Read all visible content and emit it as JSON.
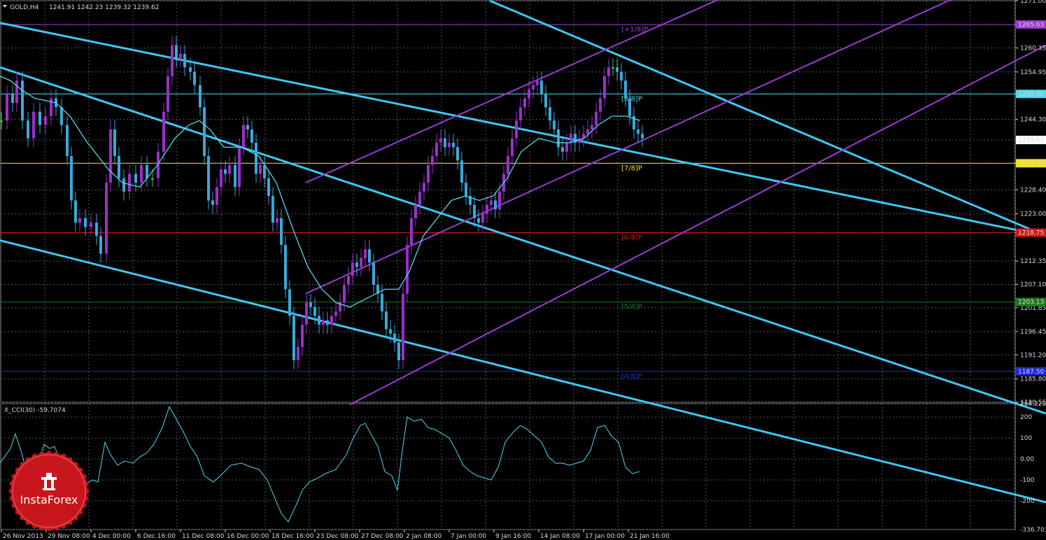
{
  "colors": {
    "background": "#000000",
    "grid": "#4a5a6a",
    "bull_candle": "#9a30c8",
    "bear_candle": "#3aa8d8",
    "neutral_candle": "#2ec84a",
    "ma_line": "#52d8e8",
    "trend_channel": "#3ec8f0",
    "regression_channel": "#9a3ccf",
    "cci_line": "#52d8e8",
    "murrey_plus1": "#9a3ccf",
    "murrey_8": "#52d8e8",
    "murrey_7": "#f0e020",
    "murrey_6": "#d81818",
    "murrey_5": "#1e7a1e",
    "murrey_4": "#1d2ad8",
    "logo_red": "#c8161d"
  },
  "header": {
    "symbol_text": "GOLD,H4",
    "ohlc_text": "1241.91 1242.23 1239.32 1239.62"
  },
  "logo": {
    "name": "InstaForex"
  },
  "chart_data": [
    {
      "type": "candlestick",
      "title": "GOLD,H4",
      "ylim": [
        1180.55,
        1271.0
      ],
      "y_ticks": [
        "1271.00",
        "1265.63",
        "1260.35",
        "1254.95",
        "1250.00",
        "1244.30",
        "1239.62",
        "1234.38",
        "1228.40",
        "1223.00",
        "1218.75",
        "1212.35",
        "1207.10",
        "1201.85",
        "1196.45",
        "1191.20",
        "1185.80",
        "1180.55"
      ],
      "x_ticks": [
        "26 Nov 2013",
        "29 Nov 08:00",
        "4 Dec 00:00",
        "6 Dec 16:00",
        "11 Dec 08:00",
        "16 Dec 00:00",
        "18 Dec 16:00",
        "23 Dec 08:00",
        "27 Dec 08:00",
        "2 Jan 08:00",
        "7 Jan 00:00",
        "9 Jan 16:00",
        "14 Jan 08:00",
        "17 Jan 00:00",
        "21 Jan 16:00"
      ],
      "price_series": [
        [
          0,
          1244
        ],
        [
          8,
          1250
        ],
        [
          16,
          1248
        ],
        [
          22,
          1253
        ],
        [
          30,
          1244
        ],
        [
          38,
          1240
        ],
        [
          46,
          1246
        ],
        [
          55,
          1243
        ],
        [
          63,
          1245
        ],
        [
          71,
          1249
        ],
        [
          78,
          1247
        ],
        [
          86,
          1243
        ],
        [
          94,
          1236
        ],
        [
          100,
          1226
        ],
        [
          106,
          1221
        ],
        [
          112,
          1222
        ],
        [
          120,
          1220
        ],
        [
          128,
          1221
        ],
        [
          136,
          1218
        ],
        [
          142,
          1214
        ],
        [
          150,
          1230
        ],
        [
          156,
          1242
        ],
        [
          162,
          1236
        ],
        [
          168,
          1231
        ],
        [
          175,
          1228
        ],
        [
          183,
          1232
        ],
        [
          192,
          1230
        ],
        [
          200,
          1234
        ],
        [
          208,
          1231
        ],
        [
          216,
          1231
        ],
        [
          224,
          1237
        ],
        [
          232,
          1246
        ],
        [
          238,
          1254
        ],
        [
          244,
          1261
        ],
        [
          250,
          1258
        ],
        [
          256,
          1259
        ],
        [
          262,
          1256
        ],
        [
          270,
          1255
        ],
        [
          276,
          1252
        ],
        [
          284,
          1247
        ],
        [
          290,
          1236
        ],
        [
          296,
          1226
        ],
        [
          302,
          1225
        ],
        [
          308,
          1229
        ],
        [
          314,
          1233
        ],
        [
          320,
          1232
        ],
        [
          326,
          1234
        ],
        [
          334,
          1229
        ],
        [
          340,
          1238
        ],
        [
          346,
          1243
        ],
        [
          352,
          1242
        ],
        [
          358,
          1239
        ],
        [
          364,
          1232
        ],
        [
          370,
          1234
        ],
        [
          376,
          1231
        ],
        [
          382,
          1227
        ],
        [
          388,
          1221
        ],
        [
          394,
          1222
        ],
        [
          400,
          1216
        ],
        [
          406,
          1206
        ],
        [
          412,
          1200
        ],
        [
          418,
          1190
        ],
        [
          424,
          1193
        ],
        [
          430,
          1198
        ],
        [
          436,
          1203
        ],
        [
          442,
          1202
        ],
        [
          448,
          1200
        ],
        [
          454,
          1198
        ],
        [
          460,
          1199
        ],
        [
          466,
          1198
        ],
        [
          472,
          1200
        ],
        [
          478,
          1201
        ],
        [
          484,
          1203
        ],
        [
          490,
          1207
        ],
        [
          496,
          1209
        ],
        [
          502,
          1212
        ],
        [
          508,
          1211
        ],
        [
          514,
          1213
        ],
        [
          520,
          1215
        ],
        [
          526,
          1212
        ],
        [
          532,
          1207
        ],
        [
          538,
          1205
        ],
        [
          544,
          1201
        ],
        [
          550,
          1197
        ],
        [
          556,
          1196
        ],
        [
          562,
          1194
        ],
        [
          568,
          1190
        ],
        [
          574,
          1205
        ],
        [
          580,
          1216
        ],
        [
          586,
          1222
        ],
        [
          592,
          1225
        ],
        [
          598,
          1228
        ],
        [
          604,
          1230
        ],
        [
          610,
          1234
        ],
        [
          616,
          1236
        ],
        [
          622,
          1239
        ],
        [
          628,
          1240
        ],
        [
          634,
          1238
        ],
        [
          640,
          1239
        ],
        [
          646,
          1238
        ],
        [
          652,
          1235
        ],
        [
          658,
          1230
        ],
        [
          664,
          1227
        ],
        [
          670,
          1225
        ],
        [
          676,
          1222
        ],
        [
          682,
          1221
        ],
        [
          688,
          1223
        ],
        [
          694,
          1225
        ],
        [
          700,
          1226
        ],
        [
          706,
          1224
        ],
        [
          712,
          1228
        ],
        [
          718,
          1232
        ],
        [
          724,
          1236
        ],
        [
          730,
          1240
        ],
        [
          736,
          1244
        ],
        [
          742,
          1247
        ],
        [
          748,
          1249
        ],
        [
          754,
          1251
        ],
        [
          760,
          1252
        ],
        [
          766,
          1253
        ],
        [
          772,
          1250
        ],
        [
          778,
          1247
        ],
        [
          784,
          1244
        ],
        [
          790,
          1242
        ],
        [
          796,
          1238
        ],
        [
          802,
          1237
        ],
        [
          808,
          1239
        ],
        [
          814,
          1241
        ],
        [
          820,
          1239
        ],
        [
          826,
          1240
        ],
        [
          832,
          1241
        ],
        [
          838,
          1242
        ],
        [
          844,
          1243
        ],
        [
          850,
          1246
        ],
        [
          856,
          1249
        ],
        [
          862,
          1254
        ],
        [
          868,
          1256
        ],
        [
          874,
          1256
        ],
        [
          880,
          1255
        ],
        [
          886,
          1253
        ],
        [
          892,
          1249
        ],
        [
          898,
          1245
        ],
        [
          904,
          1242
        ],
        [
          910,
          1241
        ],
        [
          916,
          1240
        ]
      ],
      "ma_series": [
        [
          0,
          1254
        ],
        [
          15,
          1253
        ],
        [
          30,
          1251
        ],
        [
          50,
          1249
        ],
        [
          80,
          1248
        ],
        [
          100,
          1245
        ],
        [
          125,
          1239
        ],
        [
          155,
          1233
        ],
        [
          175,
          1230
        ],
        [
          200,
          1229
        ],
        [
          225,
          1234
        ],
        [
          250,
          1240
        ],
        [
          270,
          1243
        ],
        [
          285,
          1244
        ],
        [
          300,
          1242
        ],
        [
          320,
          1238
        ],
        [
          345,
          1238
        ],
        [
          370,
          1236
        ],
        [
          395,
          1230
        ],
        [
          420,
          1219
        ],
        [
          440,
          1211
        ],
        [
          460,
          1206
        ],
        [
          480,
          1203
        ],
        [
          500,
          1202
        ],
        [
          525,
          1204
        ],
        [
          550,
          1206
        ],
        [
          570,
          1206
        ],
        [
          585,
          1210
        ],
        [
          605,
          1218
        ],
        [
          625,
          1222
        ],
        [
          645,
          1226
        ],
        [
          665,
          1227
        ],
        [
          685,
          1226
        ],
        [
          705,
          1227
        ],
        [
          725,
          1231
        ],
        [
          745,
          1237
        ],
        [
          770,
          1240
        ],
        [
          795,
          1239
        ],
        [
          815,
          1239
        ],
        [
          835,
          1240
        ],
        [
          855,
          1243
        ],
        [
          875,
          1245
        ],
        [
          895,
          1245
        ],
        [
          915,
          1244
        ]
      ],
      "trend_channel": {
        "upper": [
          [
            0,
            1266
          ],
          [
            1495,
            1218
          ]
        ],
        "middle": [
          [
            0,
            1256
          ],
          [
            1495,
            1178
          ]
        ],
        "lower": [
          [
            0,
            1217
          ],
          [
            1495,
            1158
          ]
        ],
        "outer": [
          [
            700,
            1271
          ],
          [
            1495,
            1218
          ]
        ]
      },
      "regression_channel": {
        "upper": [
          [
            437,
            1230
          ],
          [
            1495,
            1304
          ]
        ],
        "middle": [
          [
            437,
            1205
          ],
          [
            1495,
            1281
          ]
        ],
        "lower": [
          [
            500,
            1180
          ],
          [
            1495,
            1261
          ]
        ]
      },
      "murrey_levels": [
        {
          "label": "[+1/8]P",
          "price_label": "1265.63",
          "value": 1265.63,
          "color_key": "murrey_plus1"
        },
        {
          "label": "[8/8]P",
          "price_label": "1250.00",
          "value": 1250.0,
          "color_key": "murrey_8"
        },
        {
          "label": "[7/8]P",
          "price_label": "1234.38",
          "value": 1234.38,
          "color_key": "murrey_7"
        },
        {
          "label": "[6/8]P",
          "price_label": "1218.75",
          "value": 1218.75,
          "color_key": "murrey_6"
        },
        {
          "label": "[5/8]P",
          "price_label": "1203.13",
          "value": 1203.13,
          "color_key": "murrey_5"
        },
        {
          "label": "[4/8]P",
          "price_label": "1187.50",
          "value": 1187.5,
          "color_key": "murrey_4"
        }
      ],
      "current_price_label": "1239.62"
    },
    {
      "type": "line",
      "title": "X_CCI(30) -59.7074",
      "ylim": [
        -336.7034,
        264.2204
      ],
      "y_ticks": [
        "264.2204",
        "200",
        "100",
        "0.00",
        "-100",
        "-200",
        "-336.7034"
      ],
      "series": [
        [
          0,
          -20
        ],
        [
          15,
          50
        ],
        [
          22,
          120
        ],
        [
          30,
          40
        ],
        [
          38,
          -60
        ],
        [
          46,
          -90
        ],
        [
          55,
          -20
        ],
        [
          63,
          70
        ],
        [
          71,
          50
        ],
        [
          78,
          60
        ],
        [
          86,
          -10
        ],
        [
          94,
          -60
        ],
        [
          100,
          -90
        ],
        [
          110,
          -150
        ],
        [
          120,
          -130
        ],
        [
          132,
          -100
        ],
        [
          140,
          -110
        ],
        [
          150,
          80
        ],
        [
          158,
          20
        ],
        [
          168,
          -30
        ],
        [
          178,
          -10
        ],
        [
          190,
          -20
        ],
        [
          200,
          10
        ],
        [
          210,
          30
        ],
        [
          220,
          70
        ],
        [
          232,
          150
        ],
        [
          242,
          250
        ],
        [
          252,
          190
        ],
        [
          262,
          130
        ],
        [
          272,
          60
        ],
        [
          282,
          10
        ],
        [
          292,
          -80
        ],
        [
          305,
          -110
        ],
        [
          318,
          -70
        ],
        [
          330,
          -30
        ],
        [
          345,
          -20
        ],
        [
          360,
          -40
        ],
        [
          370,
          -50
        ],
        [
          382,
          -100
        ],
        [
          392,
          -180
        ],
        [
          402,
          -260
        ],
        [
          412,
          -300
        ],
        [
          422,
          -230
        ],
        [
          432,
          -150
        ],
        [
          442,
          -110
        ],
        [
          455,
          -90
        ],
        [
          465,
          -70
        ],
        [
          480,
          -50
        ],
        [
          495,
          20
        ],
        [
          505,
          100
        ],
        [
          515,
          160
        ],
        [
          522,
          170
        ],
        [
          530,
          120
        ],
        [
          540,
          60
        ],
        [
          550,
          -60
        ],
        [
          560,
          -80
        ],
        [
          568,
          -150
        ],
        [
          575,
          40
        ],
        [
          582,
          200
        ],
        [
          592,
          180
        ],
        [
          602,
          190
        ],
        [
          612,
          150
        ],
        [
          622,
          140
        ],
        [
          632,
          120
        ],
        [
          642,
          100
        ],
        [
          652,
          40
        ],
        [
          662,
          -30
        ],
        [
          672,
          -60
        ],
        [
          682,
          -80
        ],
        [
          692,
          -90
        ],
        [
          702,
          -100
        ],
        [
          712,
          -40
        ],
        [
          722,
          80
        ],
        [
          734,
          130
        ],
        [
          744,
          160
        ],
        [
          754,
          140
        ],
        [
          764,
          110
        ],
        [
          774,
          80
        ],
        [
          784,
          10
        ],
        [
          794,
          -20
        ],
        [
          804,
          -20
        ],
        [
          814,
          -30
        ],
        [
          824,
          -20
        ],
        [
          834,
          -10
        ],
        [
          844,
          40
        ],
        [
          854,
          150
        ],
        [
          864,
          160
        ],
        [
          874,
          110
        ],
        [
          884,
          80
        ],
        [
          894,
          -40
        ],
        [
          904,
          -70
        ],
        [
          914,
          -60
        ]
      ]
    }
  ]
}
